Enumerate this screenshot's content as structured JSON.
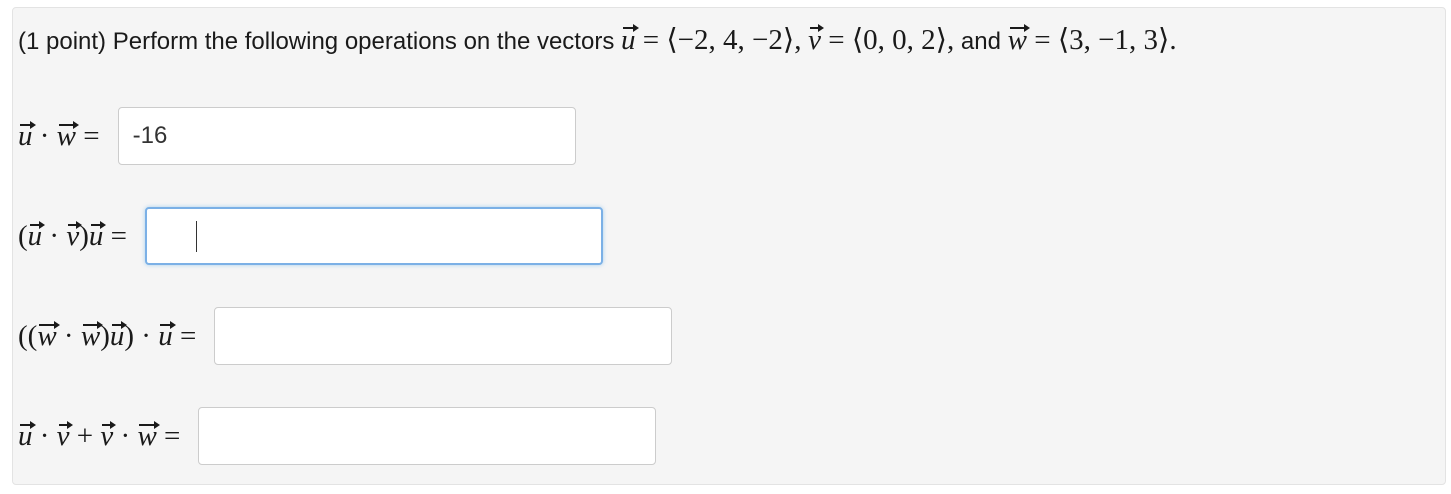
{
  "problem": {
    "points": "(1 point)",
    "intro": "Perform the following operations on the vectors",
    "u_def": "⟨−2, 4, −2⟩",
    "v_def": "⟨0, 0, 2⟩",
    "and": "and",
    "w_def": "⟨3, −1, 3⟩",
    "vector_u": "u",
    "vector_v": "v",
    "vector_w": "w"
  },
  "questions": [
    {
      "value": "-16",
      "placeholder": ""
    },
    {
      "value": "",
      "placeholder": ""
    },
    {
      "value": "",
      "placeholder": ""
    },
    {
      "value": "",
      "placeholder": ""
    }
  ],
  "colors": {
    "panel_bg": "#f5f5f5",
    "focus_border": "#7bb0e6",
    "input_border": "#cccccc"
  }
}
